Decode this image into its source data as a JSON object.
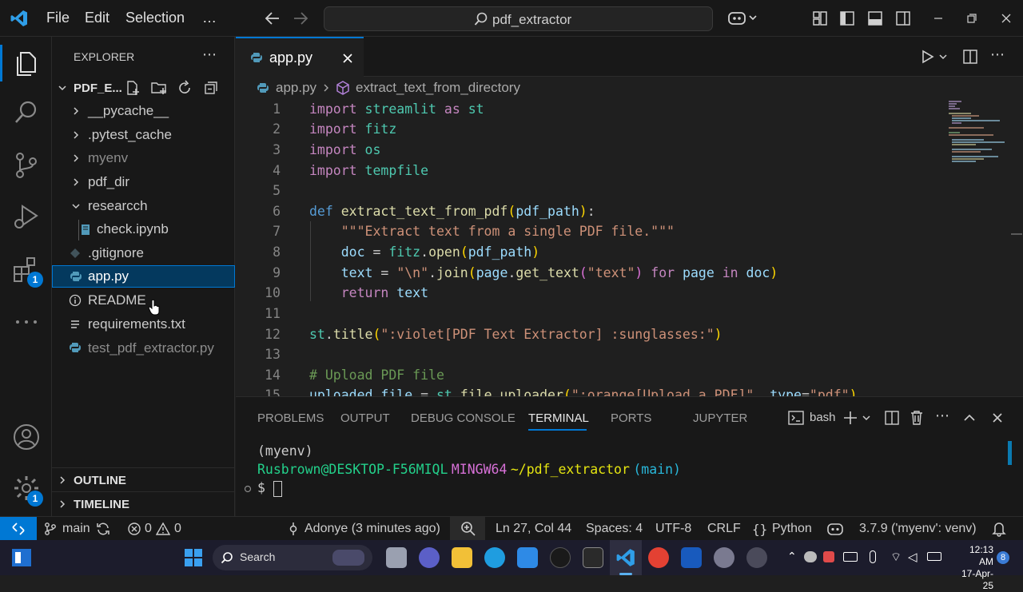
{
  "titlebar": {
    "menu": [
      "File",
      "Edit",
      "Selection",
      "…"
    ],
    "search_text": "pdf_extractor"
  },
  "activity_badges": {
    "extensions": "1",
    "manage": "1"
  },
  "explorer": {
    "title": "EXPLORER",
    "folder_name": "PDF_E...",
    "items": [
      {
        "label": "__pycache__",
        "type": "folder"
      },
      {
        "label": ".pytest_cache",
        "type": "folder"
      },
      {
        "label": "myenv",
        "type": "folder",
        "dim": true
      },
      {
        "label": "pdf_dir",
        "type": "folder"
      },
      {
        "label": "researcch",
        "type": "folder-open"
      },
      {
        "label": "check.ipynb",
        "type": "file"
      },
      {
        "label": ".gitignore",
        "type": "file"
      },
      {
        "label": "app.py",
        "type": "file",
        "selected": true
      },
      {
        "label": "README",
        "type": "file"
      },
      {
        "label": "requirements.txt",
        "type": "file"
      },
      {
        "label": "test_pdf_extractor.py",
        "type": "file",
        "dim": true
      }
    ],
    "outline": "OUTLINE",
    "timeline": "TIMELINE"
  },
  "editor": {
    "tab_label": "app.py",
    "breadcrumb_file": "app.py",
    "breadcrumb_symbol": "extract_text_from_directory",
    "line_numbers": [
      "1",
      "2",
      "3",
      "4",
      "5",
      "6",
      "7",
      "8",
      "9",
      "10",
      "11",
      "12",
      "13",
      "14",
      "15"
    ]
  },
  "panel": {
    "tabs": [
      "PROBLEMS",
      "OUTPUT",
      "DEBUG CONSOLE",
      "TERMINAL",
      "PORTS",
      "JUPYTER"
    ],
    "active_tab": "TERMINAL",
    "shell": "bash",
    "terminal": {
      "env": "(myenv)",
      "user_host": "Rusbrown@DESKTOP-F56MIQL",
      "system": "MINGW64",
      "path": "~/pdf_extractor",
      "branch": "(main)",
      "prompt": "$"
    }
  },
  "statusbar": {
    "branch": "main",
    "errors": "0",
    "warnings": "0",
    "blame": "Adonye (3 minutes ago)",
    "position": "Ln 27, Col 44",
    "spaces": "Spaces: 4",
    "encoding": "UTF-8",
    "eol": "CRLF",
    "language": "Python",
    "interpreter": "3.7.9 ('myenv': venv)"
  },
  "taskbar": {
    "search": "Search",
    "time": "12:13 AM",
    "date": "17-Apr-25",
    "notification_count": "8"
  },
  "colors": {
    "accent": "#0078d4",
    "selection": "#04395e",
    "keyword": "#c586c0",
    "string": "#ce9178",
    "function": "#dcdcaa",
    "comment": "#6a9955"
  }
}
